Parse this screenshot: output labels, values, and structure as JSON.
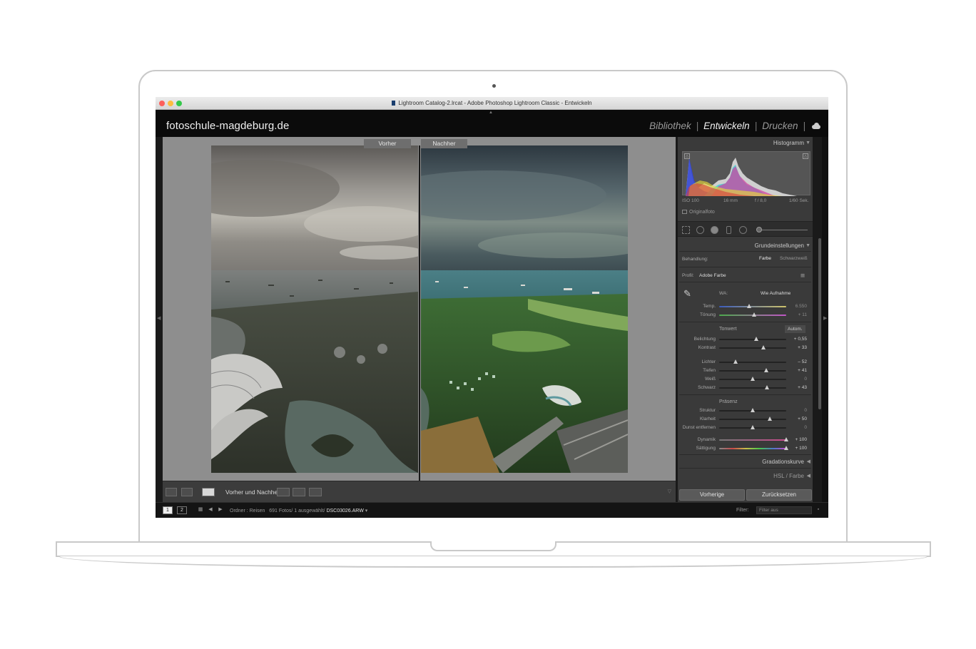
{
  "window": {
    "title": "Lightroom Catalog-2.lrcat - Adobe Photoshop Lightroom Classic - Entwickeln"
  },
  "topbar": {
    "identity_plate": "fotoschule-magdeburg.de",
    "modules": [
      "Bibliothek",
      "Entwickeln",
      "Drucken"
    ],
    "active_module": "Entwickeln",
    "sep": "|"
  },
  "view": {
    "before_label": "Vorher",
    "after_label": "Nachher"
  },
  "toolbar": {
    "before_after_label": "Vorher und Nachher:"
  },
  "panel": {
    "histogram": {
      "title": "Histogramm",
      "iso": "ISO 100",
      "focal": "16 mm",
      "aperture": "f / 8,0",
      "shutter": "1/60 Sek.",
      "original": "Originalfoto"
    },
    "basic": {
      "title": "Grundeinstellungen",
      "treatment_label": "Behandlung:",
      "treatment_color": "Farbe",
      "treatment_bw": "Schwarzweiß",
      "profile_label": "Profil:",
      "profile_value": "Adobe Farbe",
      "wb_label": "WA:",
      "wb_value": "Wie Aufnahme",
      "tone_head": "Tonwert",
      "auto": "Autom.",
      "presence_head": "Präsenz"
    },
    "sliders": {
      "temp": {
        "label": "Temp.",
        "value": "6.550",
        "level": 0.45
      },
      "tint": {
        "label": "Tönung",
        "value": "+ 11",
        "level": 0.52
      },
      "exposure": {
        "label": "Belichtung",
        "value": "+ 0,55",
        "level": 0.55
      },
      "contrast": {
        "label": "Kontrast",
        "value": "+ 33",
        "level": 0.66
      },
      "highlights": {
        "label": "Lichter",
        "value": "– 52",
        "level": 0.24
      },
      "shadows": {
        "label": "Tiefen",
        "value": "+ 41",
        "level": 0.7
      },
      "whites": {
        "label": "Weiß",
        "value": "0",
        "level": 0.5
      },
      "blacks": {
        "label": "Schwarz",
        "value": "+ 43",
        "level": 0.71
      },
      "texture": {
        "label": "Struktur",
        "value": "0",
        "level": 0.5
      },
      "clarity": {
        "label": "Klarheit",
        "value": "+ 50",
        "level": 0.75
      },
      "dehaze": {
        "label": "Dunst entfernen",
        "value": "0",
        "level": 0.5
      },
      "vibrance": {
        "label": "Dynamik",
        "value": "+ 100",
        "level": 1.0
      },
      "saturation": {
        "label": "Sättigung",
        "value": "+ 100",
        "level": 1.0
      }
    },
    "tone_curve": "Gradationskurve",
    "hsl": "HSL / Farbe",
    "prev_button": "Vorherige",
    "reset_button": "Zurücksetzen"
  },
  "filmstrip": {
    "screen1": "1",
    "screen2": "2",
    "source": "Ordner : Reisen",
    "count": "691 Fotos/ 1 ausgewählt/",
    "filename": "DSC03026.ARW",
    "filter_label": "Filter:",
    "filter_value": "Filter aus"
  },
  "colors": {
    "accent": "#f2f2f2",
    "panel_bg": "#3a3a3a",
    "canvas_bg": "#8e8e8e"
  }
}
